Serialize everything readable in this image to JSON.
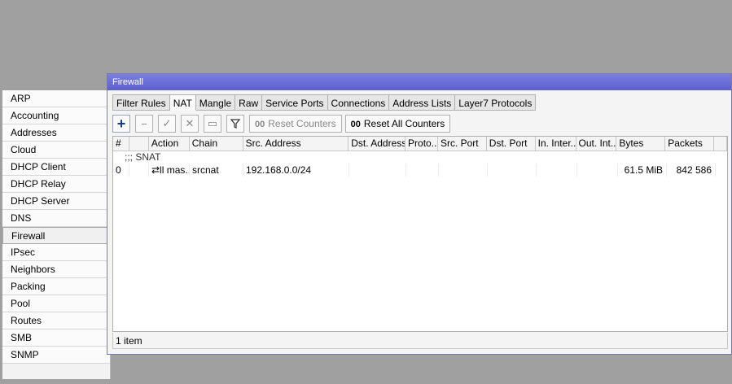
{
  "menu": {
    "items": [
      "ARP",
      "Accounting",
      "Addresses",
      "Cloud",
      "DHCP Client",
      "DHCP Relay",
      "DHCP Server",
      "DNS",
      "Firewall",
      "IPsec",
      "Neighbors",
      "Packing",
      "Pool",
      "Routes",
      "SMB",
      "SNMP"
    ],
    "active": "Firewall"
  },
  "window": {
    "title": "Firewall",
    "tabs": [
      "Filter Rules",
      "NAT",
      "Mangle",
      "Raw",
      "Service Ports",
      "Connections",
      "Address Lists",
      "Layer7 Protocols"
    ],
    "active_tab": "NAT",
    "toolbar": {
      "icons": [
        "plus-icon",
        "minus-icon",
        "check-icon",
        "cross-icon",
        "note-icon",
        "filter-icon"
      ],
      "reset_counters": "Reset Counters",
      "reset_all_counters": "Reset All Counters",
      "counter_glyph": "00"
    },
    "table": {
      "columns": [
        "#",
        "",
        "Action",
        "Chain",
        "Src. Address",
        "Dst. Address",
        "Proto...",
        "Src. Port",
        "Dst. Port",
        "In. Inter...",
        "Out. Int...",
        "Bytes",
        "Packets"
      ],
      "comment": ";;; SNAT",
      "rows": [
        {
          "num": "0",
          "flag": "",
          "action": "⇄ll mas...",
          "chain": "srcnat",
          "src_address": "192.168.0.0/24",
          "dst_address": "",
          "proto": "",
          "src_port": "",
          "dst_port": "",
          "in_iface": "",
          "out_iface": "",
          "bytes": "61.5 MiB",
          "packets": "842 586"
        }
      ]
    },
    "status": "1 item"
  }
}
